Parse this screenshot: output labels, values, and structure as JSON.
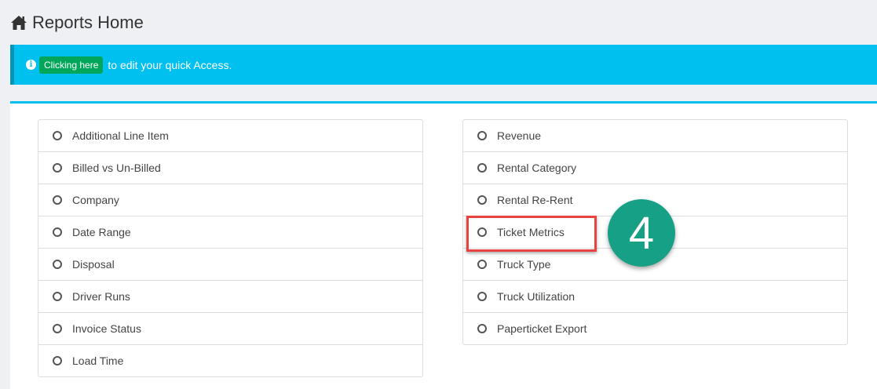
{
  "header": {
    "icon": "home-icon",
    "title": "Reports Home"
  },
  "alert": {
    "icon": "info-icon",
    "icon_glyph": "i",
    "button_label": "Clicking here",
    "text": "to edit your quick Access.",
    "bg_color": "#00c0ef",
    "button_color": "#00a65a"
  },
  "reports": {
    "left": [
      "Additional Line Item",
      "Billed vs Un-Billed",
      "Company",
      "Date Range",
      "Disposal",
      "Driver Runs",
      "Invoice Status",
      "Load Time"
    ],
    "right": [
      "Revenue",
      "Rental Category",
      "Rental Re-Rent",
      "Ticket Metrics",
      "Truck Type",
      "Truck Utilization",
      "Paperticket Export"
    ]
  },
  "annotation": {
    "step_number": "4",
    "highlight_color": "#e8413f",
    "badge_color": "#16a085"
  }
}
